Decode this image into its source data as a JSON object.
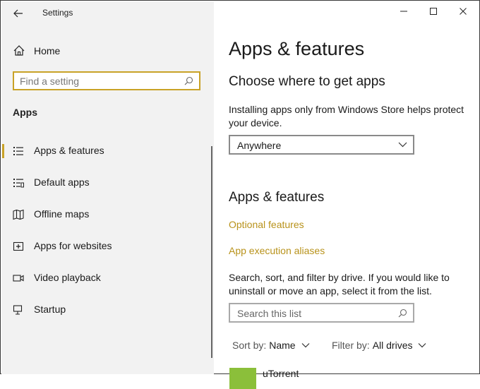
{
  "window": {
    "title": "Settings",
    "controls": {
      "minimize": "—",
      "maximize": "☐",
      "close": "✕"
    }
  },
  "sidebar": {
    "home_label": "Home",
    "search_placeholder": "Find a setting",
    "section_label": "Apps",
    "items": [
      {
        "label": "Apps & features",
        "icon": "apps-features-icon",
        "selected": true
      },
      {
        "label": "Default apps",
        "icon": "default-apps-icon"
      },
      {
        "label": "Offline maps",
        "icon": "offline-maps-icon"
      },
      {
        "label": "Apps for websites",
        "icon": "apps-websites-icon"
      },
      {
        "label": "Video playback",
        "icon": "video-playback-icon"
      },
      {
        "label": "Startup",
        "icon": "startup-icon"
      }
    ]
  },
  "main": {
    "title": "Apps & features",
    "choose": {
      "heading": "Choose where to get apps",
      "description": "Installing apps only from Windows Store helps protect your device.",
      "dropdown_value": "Anywhere"
    },
    "features": {
      "heading": "Apps & features",
      "links": [
        "Optional features",
        "App execution aliases"
      ],
      "description": "Search, sort, and filter by drive. If you would like to uninstall or move an app, select it from the list.",
      "search_placeholder": "Search this list",
      "sort_key": "Sort by:",
      "sort_value": "Name",
      "filter_key": "Filter by:",
      "filter_value": "All drives"
    },
    "apps": [
      {
        "name": "uTorrent"
      }
    ]
  },
  "colors": {
    "accent": "#c9a227",
    "link": "#b8921a",
    "sidebar_bg": "#f2f2f2"
  }
}
